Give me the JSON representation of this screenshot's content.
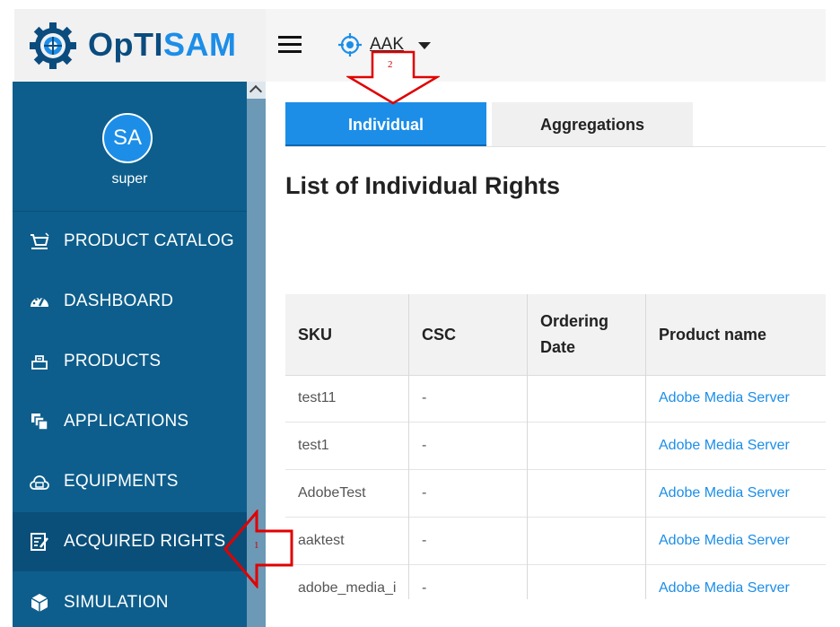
{
  "logo": {
    "part1": "Op",
    "part2": "TI",
    "part3": "SAM"
  },
  "topbar": {
    "entity_name": "AAK",
    "menu_icon": "hamburger-menu-icon",
    "entity_icon": "entity-scope-icon"
  },
  "user": {
    "initials": "SA",
    "name": "super"
  },
  "sidebar": {
    "items": [
      {
        "label": "PRODUCT CATALOG",
        "icon": "cart-icon"
      },
      {
        "label": "DASHBOARD",
        "icon": "dashboard-icon"
      },
      {
        "label": "PRODUCTS",
        "icon": "products-icon"
      },
      {
        "label": "APPLICATIONS",
        "icon": "applications-icon"
      },
      {
        "label": "EQUIPMENTS",
        "icon": "equipments-icon"
      },
      {
        "label": "ACQUIRED RIGHTS",
        "icon": "acquired-rights-icon"
      },
      {
        "label": "SIMULATION",
        "icon": "simulation-icon"
      }
    ]
  },
  "tabs": {
    "individual": "Individual",
    "aggregations": "Aggregations"
  },
  "page_title": "List of Individual Rights",
  "table": {
    "headers": [
      "SKU",
      "CSC",
      "Ordering Date",
      "Product name"
    ],
    "rows": [
      {
        "sku": "test11",
        "csc": "-",
        "ordering_date": "",
        "product_name": "Adobe Media Server"
      },
      {
        "sku": "test1",
        "csc": "-",
        "ordering_date": "",
        "product_name": "Adobe Media Server"
      },
      {
        "sku": "AdobeTest",
        "csc": "-",
        "ordering_date": "",
        "product_name": "Adobe Media Server"
      },
      {
        "sku": "aaktest",
        "csc": "-",
        "ordering_date": "",
        "product_name": "Adobe Media Server"
      },
      {
        "sku": "adobe_media_i",
        "csc": "-",
        "ordering_date": "",
        "product_name": "Adobe Media Server"
      }
    ]
  },
  "annotations": {
    "arrow1": "1",
    "arrow2": "2"
  },
  "colors": {
    "sidebar": "#0d5e8c",
    "accent": "#1c8ee8",
    "annotation": "#e00000"
  }
}
